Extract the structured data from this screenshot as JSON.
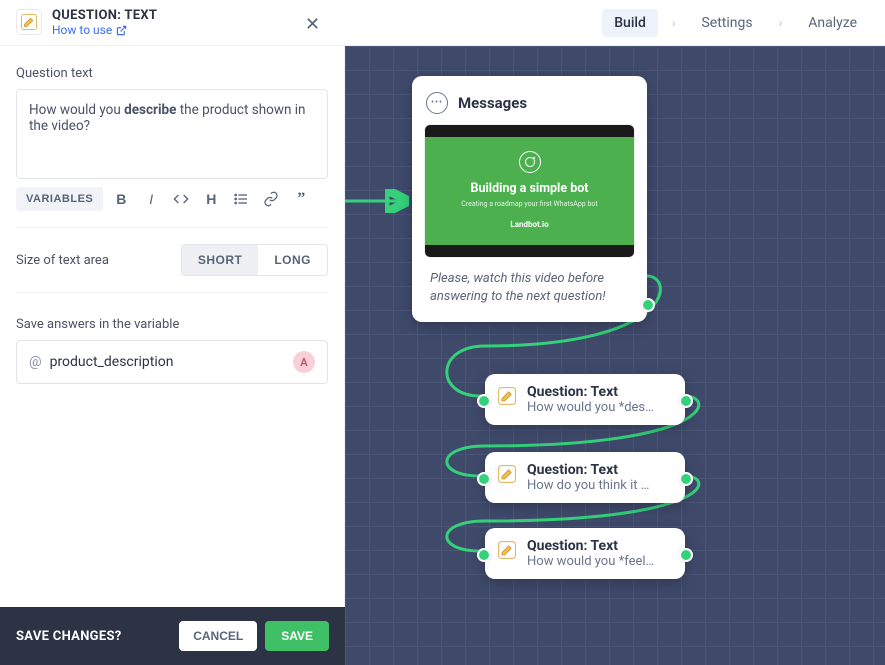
{
  "header": {
    "block_title": "QUESTION: TEXT",
    "how_to_use": "How to use",
    "tabs": {
      "build": "Build",
      "settings": "Settings",
      "analyze": "Analyze"
    }
  },
  "panel": {
    "question_text_label": "Question text",
    "question_text_value_pre": "How would you ",
    "question_text_value_bold": "describe",
    "question_text_value_post": " the product shown in the video?",
    "variables_btn": "VARIABLES",
    "size_label": "Size of text area",
    "size_short": "SHORT",
    "size_long": "LONG",
    "save_var_label": "Save answers in the variable",
    "var_prefix": "@",
    "var_name": "product_description",
    "var_badge": "A"
  },
  "footer": {
    "prompt": "SAVE CHANGES?",
    "cancel": "CANCEL",
    "save": "SAVE"
  },
  "canvas": {
    "messages_title": "Messages",
    "video_heading": "Building a simple bot",
    "video_sub": "Creating a roadmap your first WhatsApp bot",
    "video_brand": "Landbot.io",
    "messages_text": "Please, watch this video before answering to the next question!",
    "q1_title": "Question: Text",
    "q1_sub": "How would you *des…",
    "q2_title": "Question: Text",
    "q2_sub": "How do you think it …",
    "q3_title": "Question: Text",
    "q3_sub": "How would you *feel…"
  }
}
